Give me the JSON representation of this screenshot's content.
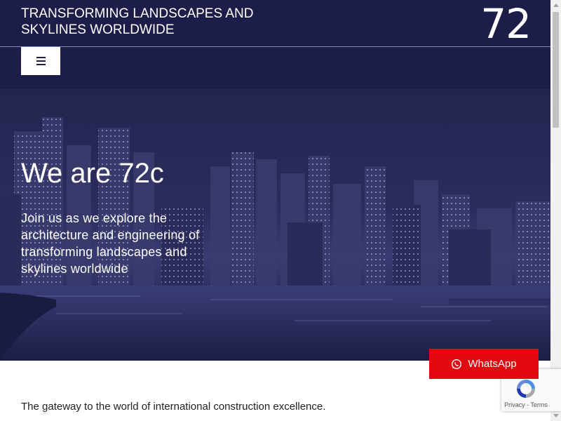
{
  "header": {
    "tagline": "TRANSFORMING LANDSCAPES AND SKYLINES WORLDWIDE",
    "logo": "72"
  },
  "nav": {
    "menu_icon": "hamburger-icon"
  },
  "hero": {
    "title": "We are 72c",
    "text": "Join us as we explore the architecture and engineering of transforming landscapes and skylines worldwide"
  },
  "content": {
    "gateway": "The gateway to the world of international construction excellence."
  },
  "whatsapp": {
    "label": "WhatsApp",
    "icon": "whatsapp-icon",
    "color": "#e1090f"
  },
  "recaptcha": {
    "links": "Privacy - Terms",
    "icon": "recaptcha-icon"
  },
  "colors": {
    "navy": "#1d1d4a",
    "hero_tint": "#2c2d5e"
  }
}
